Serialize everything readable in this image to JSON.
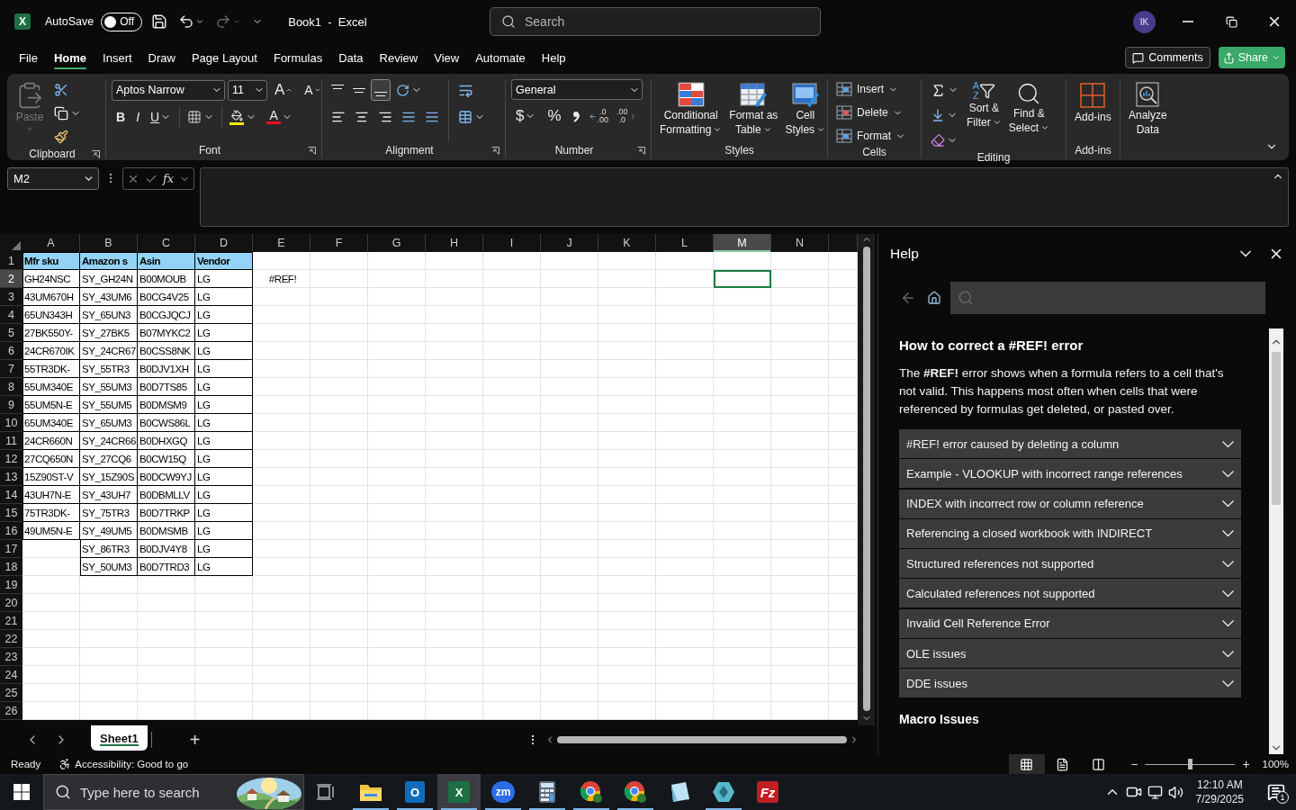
{
  "title_bar": {
    "logo_glyph": "X",
    "autosave_label": "AutoSave",
    "autosave": {
      "on": false,
      "label": "Off"
    },
    "redo": {
      "disabled": true
    },
    "title": "Book1  -  Excel",
    "search_placeholder": "Search",
    "avatar": "IK"
  },
  "menu": {
    "tabs": [
      {
        "label": "File",
        "selected": false
      },
      {
        "label": "Home",
        "selected": true
      },
      {
        "label": "Insert",
        "selected": false
      },
      {
        "label": "Draw",
        "selected": false
      },
      {
        "label": "Page Layout",
        "selected": false
      },
      {
        "label": "Formulas",
        "selected": false
      },
      {
        "label": "Data",
        "selected": false
      },
      {
        "label": "Review",
        "selected": false
      },
      {
        "label": "View",
        "selected": false
      },
      {
        "label": "Automate",
        "selected": false
      },
      {
        "label": "Help",
        "selected": false
      }
    ],
    "comments": "Comments",
    "share": "Share"
  },
  "ribbon": {
    "clipboard": {
      "label": "Clipboard",
      "paste": "Paste"
    },
    "font": {
      "label": "Font",
      "face": "Aptos Narrow",
      "size": "11",
      "grow": "A",
      "shrink": "A",
      "bold": "B",
      "italic": "I",
      "underline": "U",
      "font_color": "A"
    },
    "alignment": {
      "label": "Alignment",
      "vertical": [
        {
          "kind": "top",
          "selected": false
        },
        {
          "kind": "middle",
          "selected": false
        },
        {
          "kind": "bottom",
          "selected": true
        }
      ]
    },
    "number": {
      "label": "Number",
      "format": "General",
      "currency": "$",
      "percent": "%",
      "increase_decimal": {
        "top": ".0",
        "bottom": ".00"
      },
      "decrease_decimal": {
        "top": ".00",
        "bottom": ".0"
      }
    },
    "styles": {
      "label": "Styles",
      "items": [
        {
          "kind": "conditional",
          "lines": [
            "Conditional",
            "Formatting"
          ]
        },
        {
          "kind": "table",
          "lines": [
            "Format as",
            "Table"
          ]
        },
        {
          "kind": "cell",
          "lines": [
            "Cell",
            "Styles"
          ]
        }
      ]
    },
    "cells": {
      "label": "Cells",
      "items": [
        {
          "kind": "insert",
          "label": "Insert"
        },
        {
          "kind": "delete",
          "label": "Delete"
        },
        {
          "kind": "format",
          "label": "Format"
        }
      ]
    },
    "editing": {
      "label": "Editing",
      "sort_glyphs": [
        "A",
        "Z"
      ],
      "sort": [
        "Sort &",
        "Filter"
      ],
      "find": [
        "Find &",
        "Select"
      ]
    },
    "addins": {
      "label": "Add-ins",
      "button": "Add-ins"
    },
    "analyze": {
      "lines": [
        "Analyze",
        "Data"
      ]
    }
  },
  "formula_bar": {
    "name_box": "M2",
    "function_label": "fx"
  },
  "sheet": {
    "columns": [
      {
        "label": "A",
        "selected": false
      },
      {
        "label": "B",
        "selected": false
      },
      {
        "label": "C",
        "selected": false
      },
      {
        "label": "D",
        "selected": false
      },
      {
        "label": "E",
        "selected": false
      },
      {
        "label": "F",
        "selected": false
      },
      {
        "label": "G",
        "selected": false
      },
      {
        "label": "H",
        "selected": false
      },
      {
        "label": "I",
        "selected": false
      },
      {
        "label": "J",
        "selected": false
      },
      {
        "label": "K",
        "selected": false
      },
      {
        "label": "L",
        "selected": false
      },
      {
        "label": "M",
        "selected": true
      },
      {
        "label": "N",
        "selected": false
      }
    ],
    "rows": [
      {
        "number": "1",
        "selected": false,
        "kind": "header",
        "cells": [
          "Mfr sku",
          "Amazon s",
          "Asin",
          "Vendor"
        ]
      },
      {
        "number": "2",
        "selected": true,
        "kind": "data",
        "cells": [
          "GH24NSC",
          "SY_GH24N",
          "B00MOUB",
          "LG",
          "#REF!"
        ]
      },
      {
        "number": "3",
        "selected": false,
        "kind": "data",
        "cells": [
          "43UM670H",
          "SY_43UM6",
          "B0CG4V25",
          "LG"
        ]
      },
      {
        "number": "4",
        "selected": false,
        "kind": "data",
        "cells": [
          "65UN343H",
          "SY_65UN3",
          "B0CGJQCJ",
          "LG"
        ]
      },
      {
        "number": "5",
        "selected": false,
        "kind": "data",
        "cells": [
          "27BK550Y-",
          "SY_27BK5",
          "B07MYKC2",
          "LG"
        ]
      },
      {
        "number": "6",
        "selected": false,
        "kind": "data",
        "cells": [
          "24CR670IK",
          "SY_24CR67",
          "B0CSS8NK",
          "LG"
        ]
      },
      {
        "number": "7",
        "selected": false,
        "kind": "data",
        "cells": [
          "55TR3DK-",
          "SY_55TR3",
          "B0DJV1XH",
          "LG"
        ]
      },
      {
        "number": "8",
        "selected": false,
        "kind": "data",
        "cells": [
          "55UM340E",
          "SY_55UM3",
          "B0D7TS85",
          "LG"
        ]
      },
      {
        "number": "9",
        "selected": false,
        "kind": "data",
        "cells": [
          "55UM5N-E",
          "SY_55UM5",
          "B0DMSM9",
          "LG"
        ]
      },
      {
        "number": "10",
        "selected": false,
        "kind": "data",
        "cells": [
          "65UM340E",
          "SY_65UM3",
          "B0CWS86L",
          "LG"
        ]
      },
      {
        "number": "11",
        "selected": false,
        "kind": "data",
        "cells": [
          "24CR660N",
          "SY_24CR66",
          "B0DHXGQ",
          "LG"
        ]
      },
      {
        "number": "12",
        "selected": false,
        "kind": "data",
        "cells": [
          "27CQ650N",
          "SY_27CQ6",
          "B0CW15Q",
          "LG"
        ]
      },
      {
        "number": "13",
        "selected": false,
        "kind": "data",
        "cells": [
          "15Z90ST-V",
          "SY_15Z90S",
          "B0DCW9YJ",
          "LG"
        ]
      },
      {
        "number": "14",
        "selected": false,
        "kind": "data",
        "cells": [
          "43UH7N-E",
          "SY_43UH7",
          "B0DBMLLV",
          "LG"
        ]
      },
      {
        "number": "15",
        "selected": false,
        "kind": "data",
        "cells": [
          "75TR3DK-",
          "SY_75TR3",
          "B0D7TRKP",
          "LG"
        ]
      },
      {
        "number": "16",
        "selected": false,
        "kind": "data",
        "cells": [
          "49UM5N-E",
          "SY_49UM5",
          "B0DMSMB",
          "LG"
        ]
      },
      {
        "number": "17",
        "selected": false,
        "kind": "data",
        "cells": [
          null,
          "SY_86TR3",
          "B0DJV4Y8",
          "LG"
        ]
      },
      {
        "number": "18",
        "selected": false,
        "kind": "data",
        "cells": [
          null,
          "SY_50UM3",
          "B0D7TRD3",
          "LG"
        ]
      },
      {
        "number": "19",
        "selected": false,
        "kind": "data",
        "cells": []
      },
      {
        "number": "20",
        "selected": false,
        "kind": "data",
        "cells": []
      },
      {
        "number": "21",
        "selected": false,
        "kind": "data",
        "cells": []
      },
      {
        "number": "22",
        "selected": false,
        "kind": "data",
        "cells": []
      },
      {
        "number": "23",
        "selected": false,
        "kind": "data",
        "cells": []
      },
      {
        "number": "24",
        "selected": false,
        "kind": "data",
        "cells": []
      },
      {
        "number": "25",
        "selected": false,
        "kind": "data",
        "cells": []
      },
      {
        "number": "26",
        "selected": false,
        "kind": "data",
        "cells": []
      }
    ]
  },
  "sheet_tabs": {
    "tabs": [
      {
        "label": "Sheet1",
        "selected": true
      }
    ],
    "add": "+"
  },
  "help": {
    "title": "Help",
    "heading": "How to correct a #REF! error",
    "body": "The **#REF!** error shows when a formula refers to a cell that's not valid. This happens most often when cells that were referenced by formulas get deleted, or pasted over.",
    "sections": [
      {
        "label": "#REF! error caused by deleting a column",
        "expanded": false
      },
      {
        "label": "Example - VLOOKUP with incorrect range references",
        "expanded": false
      },
      {
        "label": "INDEX with incorrect row or column reference",
        "expanded": false
      },
      {
        "label": "Referencing a closed workbook with INDIRECT",
        "expanded": false
      },
      {
        "label": "Structured references not supported",
        "expanded": false
      },
      {
        "label": "Calculated references not supported",
        "expanded": false
      },
      {
        "label": "Invalid Cell Reference Error",
        "expanded": false
      },
      {
        "label": "OLE issues",
        "expanded": false
      },
      {
        "label": "DDE issues",
        "expanded": false
      }
    ],
    "next_heading": "Macro Issues"
  },
  "status_bar": {
    "ready": "Ready",
    "accessibility": "Accessibility: Good to go",
    "views": [
      {
        "kind": "normal",
        "selected": true
      },
      {
        "kind": "page_layout",
        "selected": false
      },
      {
        "kind": "page_break",
        "selected": false
      }
    ],
    "zoom": {
      "minus": "−",
      "plus": "+",
      "level": 0.5,
      "label": "100%"
    }
  },
  "taskbar": {
    "search_placeholder": "Type here to search",
    "apps": [
      {
        "kind": "explorer",
        "running": true,
        "active": false
      },
      {
        "kind": "outlook",
        "glyph": "O",
        "running": true,
        "active": false
      },
      {
        "kind": "excel",
        "glyph": "X",
        "running": true,
        "active": true
      },
      {
        "kind": "zoom",
        "glyph": "zm",
        "running": true,
        "active": false
      },
      {
        "kind": "calculator",
        "running": true,
        "active": false
      },
      {
        "kind": "chrome",
        "running": true,
        "active": false
      },
      {
        "kind": "chrome",
        "running": true,
        "active": false
      },
      {
        "kind": "paper",
        "running": false,
        "active": false
      },
      {
        "kind": "gem",
        "running": true,
        "active": false
      },
      {
        "kind": "filezilla",
        "glyph": "Fz",
        "running": false,
        "active": false
      }
    ],
    "time": "12:10 AM",
    "date": "7/29/2025",
    "notifications": "1"
  }
}
